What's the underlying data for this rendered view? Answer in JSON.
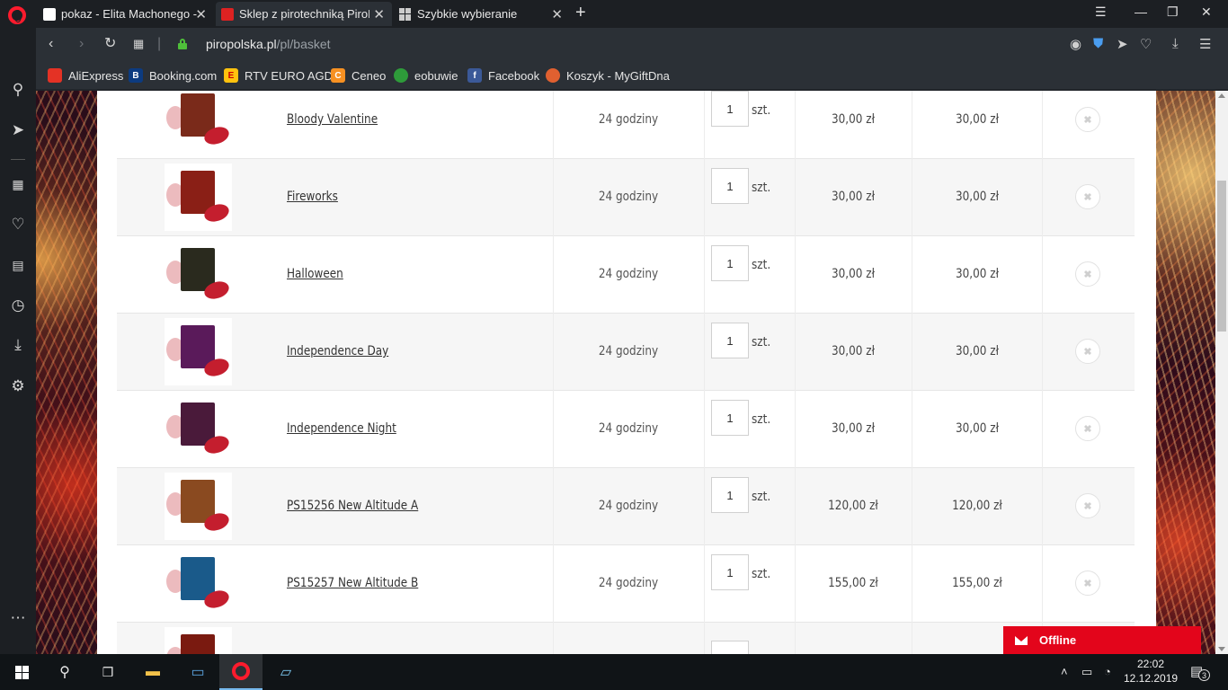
{
  "browser": {
    "tabs": [
      {
        "title": "pokaz - Elita Machonego -",
        "active": false
      },
      {
        "title": "Sklep z pirotechniką PiroPo",
        "active": true
      },
      {
        "title": "Szybkie wybieranie",
        "active": false
      }
    ],
    "url_domain": "piropolska.pl",
    "url_path": "/pl/basket",
    "bookmarks": [
      {
        "label": "AliExpress",
        "color": "#e43225"
      },
      {
        "label": "Booking.com",
        "color": "#0c3b80"
      },
      {
        "label": "RTV EURO AGD",
        "color": "#ffc20e"
      },
      {
        "label": "Ceneo",
        "color": "#f79122"
      },
      {
        "label": "eobuwie",
        "color": "#2e9b3a"
      },
      {
        "label": "Facebook",
        "color": "#3b5998"
      },
      {
        "label": "Koszyk - MyGiftDna",
        "color": "#e06030"
      }
    ]
  },
  "basket": {
    "rows": [
      {
        "name": "Bloody Valentine",
        "delivery": "24 godziny",
        "qty": "1",
        "unit": "szt.",
        "price": "30,00 zł",
        "total": "30,00 zł",
        "box_color": "#7a2a1a"
      },
      {
        "name": "Fireworks",
        "delivery": "24 godziny",
        "qty": "1",
        "unit": "szt.",
        "price": "30,00 zł",
        "total": "30,00 zł",
        "box_color": "#8a1f16"
      },
      {
        "name": "Halloween",
        "delivery": "24 godziny",
        "qty": "1",
        "unit": "szt.",
        "price": "30,00 zł",
        "total": "30,00 zł",
        "box_color": "#2a2a1e"
      },
      {
        "name": "Independence Day",
        "delivery": "24 godziny",
        "qty": "1",
        "unit": "szt.",
        "price": "30,00 zł",
        "total": "30,00 zł",
        "box_color": "#5a1a5a"
      },
      {
        "name": "Independence Night",
        "delivery": "24 godziny",
        "qty": "1",
        "unit": "szt.",
        "price": "30,00 zł",
        "total": "30,00 zł",
        "box_color": "#4a1a3a"
      },
      {
        "name": "PS15256 New Altitude A",
        "delivery": "24 godziny",
        "qty": "1",
        "unit": "szt.",
        "price": "120,00 zł",
        "total": "120,00 zł",
        "box_color": "#8a4a20"
      },
      {
        "name": "PS15257 New Altitude B",
        "delivery": "24 godziny",
        "qty": "1",
        "unit": "szt.",
        "price": "155,00 zł",
        "total": "155,00 zł",
        "box_color": "#1a5a8a"
      }
    ]
  },
  "chat": {
    "label": "Offline"
  },
  "taskbar": {
    "time": "22:02",
    "date": "12.12.2019",
    "notifications": "3"
  }
}
